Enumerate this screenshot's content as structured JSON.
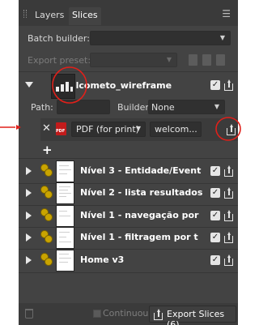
{
  "tabs": [
    {
      "label": "Layers",
      "active": false
    },
    {
      "label": "Slices",
      "active": true
    }
  ],
  "batch_builder": {
    "label": "Batch builder:",
    "value": ""
  },
  "export_preset": {
    "label": "Export preset:",
    "value": "",
    "enabled": false
  },
  "selected_slice": {
    "name": "welcometo_wireframe",
    "checked": true,
    "path_label": "Path:",
    "path_value": "",
    "builder_label": "Builder:",
    "builder_value": "None",
    "format_value": "PDF (for print)",
    "filename_value": "welcom...",
    "pdf_icon_text": "PDF"
  },
  "slices": [
    {
      "name": "Nível 3 - Entidade/Event",
      "checked": true
    },
    {
      "name": "Nível 2 - lista resultados",
      "checked": true
    },
    {
      "name": "Nível 1 - navegação por",
      "checked": true
    },
    {
      "name": "Nível 1 - filtragem por t",
      "checked": true
    },
    {
      "name": "Home v3",
      "checked": true
    }
  ],
  "footer": {
    "continuous_label": "Continuous",
    "export_label": "Export Slices (6)"
  },
  "icons": {
    "tab_menu": "hamburger-menu-icon",
    "check_glyph": "✓",
    "close_glyph": "✕",
    "add_glyph": "+"
  },
  "colors": {
    "panel_bg": "#434343",
    "annotation_red": "#e0201a",
    "layer_glyph": "#c9a400"
  }
}
